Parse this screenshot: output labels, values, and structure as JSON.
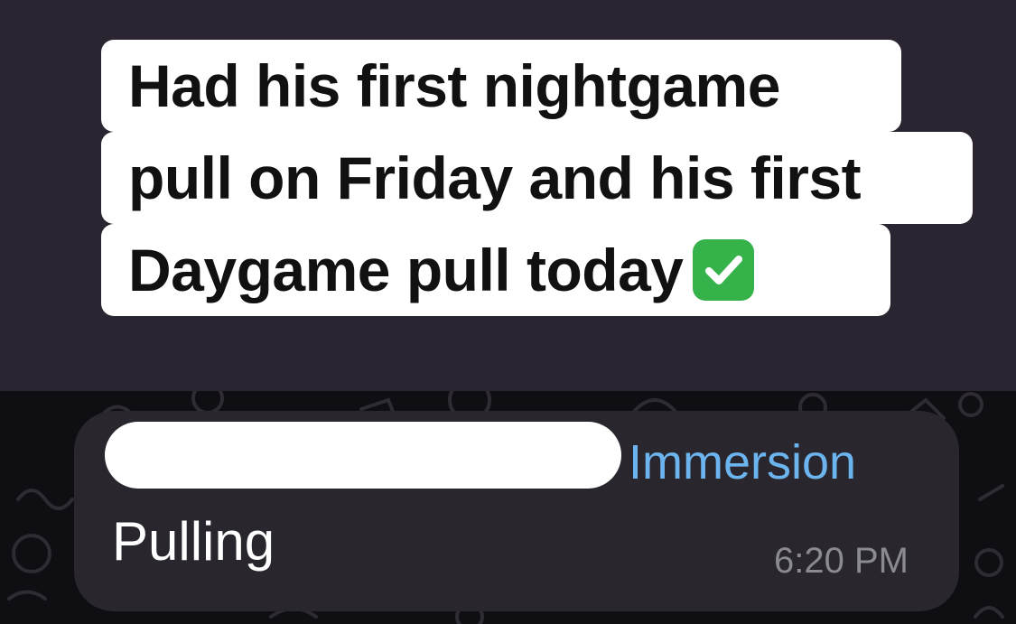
{
  "caption": {
    "line1": "Had his first nightgame",
    "line2": "pull on Friday and his first",
    "line3": "Daygame pull today",
    "icon": "check-mark-button-icon"
  },
  "message": {
    "sender_role": "Immersion",
    "text": "Pulling",
    "time": "6:20 PM"
  },
  "colors": {
    "background_top": "#2a2531",
    "chat_background": "#0f0e12",
    "bubble": "#29262e",
    "role_accent": "#6cb4ee",
    "check_green": "#35b34a"
  }
}
